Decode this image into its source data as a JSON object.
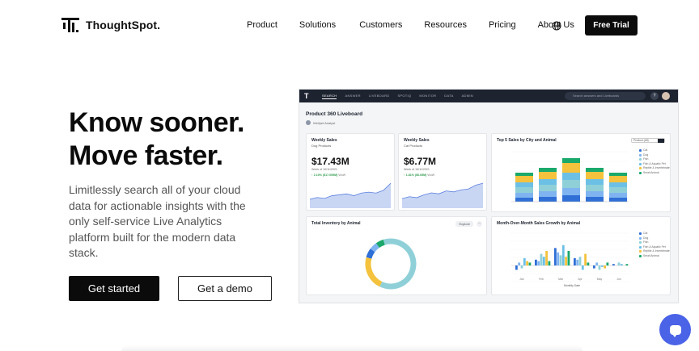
{
  "brand": {
    "name": "ThoughtSpot."
  },
  "nav": {
    "items": [
      "Product",
      "Solutions",
      "Customers",
      "Resources",
      "Pricing",
      "About Us"
    ]
  },
  "header": {
    "cta_label": "Free Trial"
  },
  "hero": {
    "headline_line1": "Know sooner.",
    "headline_line2": "Move faster.",
    "subtext": "Limitlessly search all of your cloud data for actionable insights with the only self-service Live Analytics platform built for the modern data stack.",
    "primary_cta": "Get started",
    "secondary_cta": "Get a demo"
  },
  "dashboard": {
    "tabs": [
      "SEARCH",
      "ANSWER",
      "LIVEBOARD",
      "SPOTIQ",
      "MONITOR",
      "DATA",
      "ADMIN"
    ],
    "search_placeholder": "Search answers and Liveboards",
    "title": "Product 360 Liveboard",
    "author": "Wellpet Analyst",
    "cards": {
      "dog": {
        "title": "Weekly Sales",
        "subtitle": "Dog Products",
        "value": "$17.43M",
        "week": "Week of 10/11/2021",
        "change": "↑ 2.10% ($17.059M)",
        "change_suffix": "WoW",
        "series": [
          5,
          6,
          5.5,
          7,
          7.5,
          8,
          7,
          8.5,
          9,
          8.5,
          10,
          14
        ]
      },
      "cat": {
        "title": "Weekly Sales",
        "subtitle": "Cat Products",
        "value": "$6.77M",
        "week": "Week of 10/11/2021",
        "change": "↑ 1.81% ($6.65M)",
        "change_suffix": "WoW",
        "series": [
          5,
          6,
          5.5,
          7,
          8,
          7.5,
          9,
          8.5,
          9.5,
          10,
          12,
          13
        ]
      },
      "top5": {
        "title": "Top 5 Sales by City and Animal",
        "dropdown": "Product (All)",
        "legend": [
          "Cat",
          "Dog",
          "Fish",
          "Fish & Aquatic Pet",
          "Reptile & Invertebrate",
          "Small Animal"
        ],
        "colors": [
          "#2f6fd6",
          "#7fb4f0",
          "#8fd0d8",
          "#6cc0e6",
          "#f4c23d",
          "#1aa86b"
        ]
      },
      "inventory": {
        "title": "Total Inventory by Animal",
        "button": "Explore"
      },
      "mom": {
        "title": "Month-Over-Month Sales Growth by Animal",
        "xlabel": "Monthly Date",
        "xticks": [
          "Jan",
          "Feb",
          "Mar",
          "Apr",
          "May",
          "Jun"
        ]
      }
    }
  }
}
